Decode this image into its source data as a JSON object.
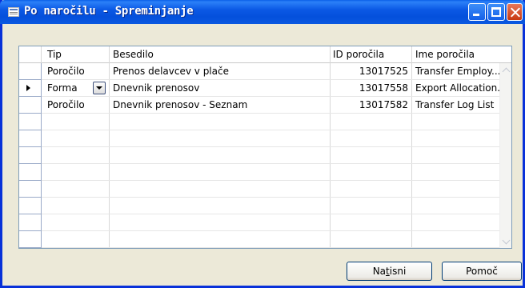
{
  "window": {
    "title": "Po naročilu - Spreminjanje"
  },
  "table": {
    "columns": {
      "tip": "Tip",
      "besedilo": "Besedilo",
      "id": "ID poročila",
      "ime": "Ime poročila"
    },
    "rows": [
      {
        "tip": "Poročilo",
        "besedilo": "Prenos delavcev v plače",
        "id": "13017525",
        "ime": "Transfer Employ..."
      },
      {
        "tip": "Forma",
        "besedilo": "Dnevnik prenosov",
        "id": "13017558",
        "ime": "Export Allocation..."
      },
      {
        "tip": "Poročilo",
        "besedilo": "Dnevnik prenosov - Seznam",
        "id": "13017582",
        "ime": "Transfer Log List"
      }
    ]
  },
  "buttons": {
    "print_before": "Na",
    "print_mnemonic": "t",
    "print_after": "isni",
    "help": "Pomoč"
  }
}
